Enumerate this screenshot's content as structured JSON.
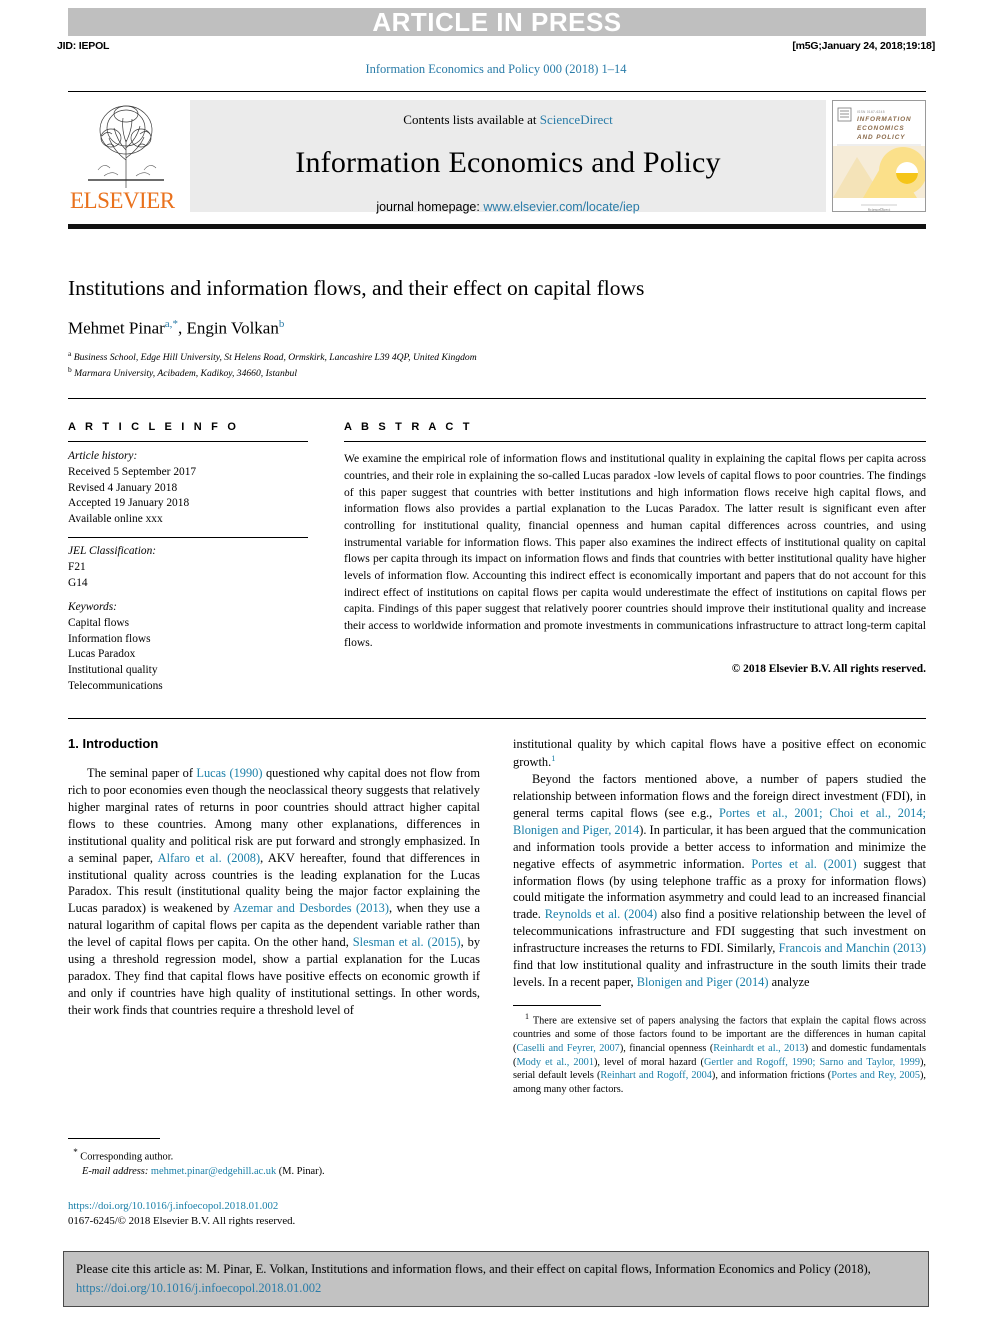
{
  "banner": {
    "press_label": "ARTICLE IN PRESS",
    "jid": "JID: IEPOL",
    "build_stamp": "[m5G;January 24, 2018;19:18]",
    "journal_ref": "Information Economics and Policy 000 (2018) 1–14"
  },
  "masthead": {
    "contents_prefix": "Contents lists available at ",
    "sciencedirect": "ScienceDirect",
    "journal_title": "Information Economics and Policy",
    "homepage_prefix": "journal homepage: ",
    "homepage_url": "www.elsevier.com/locate/iep",
    "publisher": "ELSEVIER",
    "cover_title_line1": "INFORMATION",
    "cover_title_line2": "ECONOMICS",
    "cover_title_line3": "AND POLICY"
  },
  "article": {
    "title": "Institutions and information flows, and their effect on capital flows",
    "authors_plain": "Mehmet Pinar, Engin Volkan",
    "author1": "Mehmet Pinar",
    "author1_sup": "a,",
    "author1_star": "*",
    "author2": "Engin Volkan",
    "author2_sup": "b",
    "affiliation_a": "Business School, Edge Hill University, St Helens Road, Ormskirk, Lancashire L39 4QP, United Kingdom",
    "affiliation_b": "Marmara University, Acibadem, Kadikoy,  34660, Istanbul"
  },
  "article_info": {
    "heading": "A R T I C L E   I N F O",
    "history_label": "Article history:",
    "history": [
      "Received 5 September 2017",
      "Revised 4 January 2018",
      "Accepted 19 January 2018",
      "Available online xxx"
    ],
    "jel_label": "JEL Classification:",
    "jel_codes": [
      "F21",
      "G14"
    ],
    "keywords_label": "Keywords:",
    "keywords": [
      "Capital flows",
      "Information flows",
      "Lucas Paradox",
      "Institutional quality",
      "Telecommunications"
    ]
  },
  "abstract": {
    "heading": "A B S T R A C T",
    "text": "We examine the empirical role of information flows and institutional quality in explaining the capital flows per capita across countries, and their role in explaining the so-called Lucas paradox -low levels of capital flows to poor countries. The findings of this paper suggest that countries with better institutions and high information flows receive high capital flows, and information flows also provides a partial explanation to the Lucas Paradox. The latter result is significant even after controlling for institutional quality, financial openness and human capital differences across countries, and using instrumental variable for information flows. This paper also examines the indirect effects of institutional quality on capital flows per capita through its impact on information flows and finds that countries with better institutional quality have higher levels of information flow. Accounting this indirect effect is economically important and papers that do not account for this indirect effect of institutions on capital flows per capita would underestimate the effect of institutions on capital flows per capita. Findings of this paper suggest that relatively poorer countries should improve their institutional quality and increase their access to worldwide information and promote investments in communications infrastructure to attract long-term capital flows.",
    "copyright": "© 2018 Elsevier B.V. All rights reserved."
  },
  "introduction": {
    "heading": "1. Introduction",
    "left_para1_parts": {
      "p1": "The seminal paper of ",
      "ref1": "Lucas (1990)",
      "p2": " questioned why capital does not flow from rich to poor economies even though the neoclassical theory suggests that relatively higher marginal rates of returns in poor countries should attract higher capital flows to these countries. Among many other explanations, differences in institutional quality and political risk are put forward and strongly emphasized. In a seminal paper, ",
      "ref2": "Alfaro et al. (2008)",
      "p3": ", AKV hereafter, found that differences in institutional quality across countries is the leading explanation for the Lucas Paradox. This result (institutional quality being the major factor explaining the Lucas paradox) is weakened by ",
      "ref3": "Azemar and Desbordes (2013)",
      "p4": ", when they use a natural logarithm of capital flows per capita as the dependent variable rather than the level of capital flows per capita. On the other hand, ",
      "ref4": "Slesman et al. (2015)",
      "p5": ", by using a threshold regression model, show a partial explanation for the Lucas paradox. They find that capital flows have positive effects on economic growth if and only if countries have high quality of institutional settings. In other words, their work finds that countries require a threshold level of"
    },
    "right_cont_parts": {
      "p1": "institutional quality by which capital flows have a positive effect on economic growth.",
      "fn_marker": "1"
    },
    "right_para2_parts": {
      "p1": "Beyond the factors mentioned above, a number of papers studied the relationship between information flows and the foreign direct investment (FDI), in general terms capital flows (see e.g., ",
      "ref1": "Portes et al., 2001; Choi et al., 2014; Blonigen and Piger, 2014",
      "p2": "). In particular, it has been argued that the communication and information tools provide a better access to information and minimize the negative effects of asymmetric information. ",
      "ref2": "Portes et al. (2001)",
      "p3": " suggest that information flows (by using telephone traffic as a proxy for information flows) could mitigate the information asymmetry and could lead to an increased financial trade. ",
      "ref3": "Reynolds et al. (2004)",
      "p4": " also find a positive relationship between the level of telecommunications infrastructure and FDI suggesting that such investment on infrastructure increases the returns to FDI. Similarly, ",
      "ref4": "Francois and Manchin (2013)",
      "p5": " find that low institutional quality and infrastructure in the south limits their trade levels. In a recent paper, ",
      "ref5": "Blonigen and Piger (2014)",
      "p6": " analyze"
    }
  },
  "footnote": {
    "marker": "1",
    "parts": {
      "p1": " There are extensive set of papers analysing the factors that explain the capital flows across countries and some of those factors found to be important are the differences in human capital (",
      "ref1": "Caselli and Feyrer, 2007",
      "p2": "), financial openness (",
      "ref2": "Reinhardt et al., 2013",
      "p3": ") and domestic fundamentals (",
      "ref3": "Mody et al., 2001",
      "p4": "), level of moral hazard (",
      "ref4": "Gertler and Rogoff, 1990; Sarno and Taylor, 1999",
      "p5": "), serial default levels (",
      "ref5": "Reinhart and Rogoff, 2004",
      "p6": "), and information frictions (",
      "ref6": "Portes and Rey, 2005",
      "p7": "), among many other factors."
    }
  },
  "correspondence": {
    "star": "*",
    "corresponding_author": " Corresponding author.",
    "email_label": "E-mail address:",
    "email": "mehmet.pinar@edgehill.ac.uk",
    "email_owner": " (M. Pinar).",
    "doi": "https://doi.org/10.1016/j.infoecopol.2018.01.002",
    "issn_line": "0167-6245/© 2018 Elsevier B.V. All rights reserved."
  },
  "cite_box": {
    "text_before_link": "Please cite this article as: M. Pinar, E. Volkan, Institutions and information flows, and their effect on capital flows, Information Economics and Policy (2018), ",
    "link": "https://doi.org/10.1016/j.infoecopol.2018.01.002"
  },
  "colors": {
    "link": "#1a7fa8",
    "banner_bg": "#bfbfbf",
    "elsevier_orange": "#e9711c",
    "cite_bg": "#c2c2c2"
  }
}
